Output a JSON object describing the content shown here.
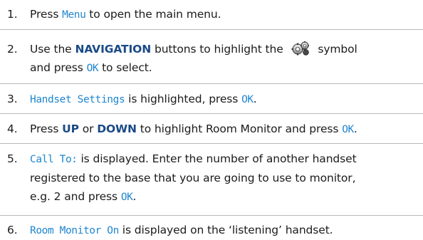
{
  "steps": [
    {
      "number": "1.",
      "parts": [
        "Press ",
        "Menu",
        " to open the main menu."
      ]
    },
    {
      "number": "2.",
      "parts": [
        "Use the ",
        "NAVIGATION",
        " buttons to highlight the ",
        " symbol",
        "and press ",
        "OK",
        " to select."
      ],
      "icon": "settings-gear-icon"
    },
    {
      "number": "3.",
      "parts": [
        "Handset Settings",
        " is highlighted, press ",
        "OK",
        "."
      ]
    },
    {
      "number": "4.",
      "parts": [
        "Press ",
        "UP",
        " or ",
        "DOWN",
        " to highlight Room Monitor and press ",
        "OK",
        "."
      ]
    },
    {
      "number": "5.",
      "parts": [
        "Call To:",
        " is displayed.  Enter the number of another handset",
        "registered to the base that you are going to use to monitor,",
        "e.g. 2 and press ",
        "OK",
        "."
      ]
    },
    {
      "number": "6.",
      "parts": [
        "Room Monitor On",
        " is displayed on the ‘listening’ handset."
      ]
    }
  ],
  "colors": {
    "text": "#1b1b1b",
    "bold": "#1a4a86",
    "lcd": "#1f86d0",
    "divider": "#b9b9b9"
  }
}
